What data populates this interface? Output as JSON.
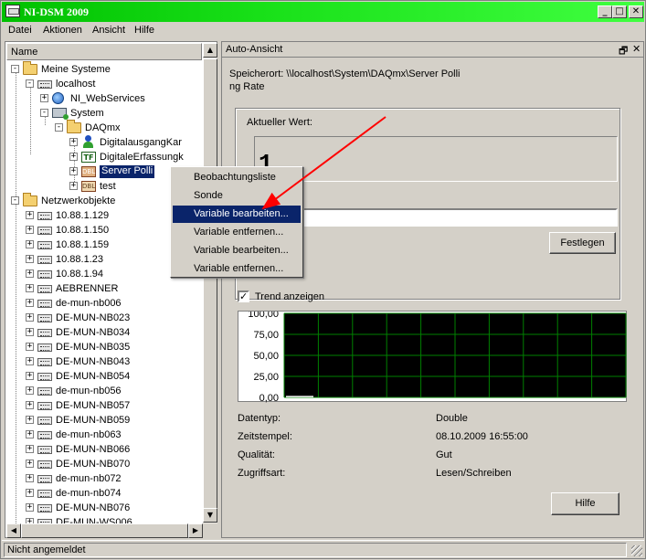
{
  "window": {
    "title": "NI-DSM 2009",
    "min": "_",
    "max": "□",
    "close": "✕"
  },
  "menu": [
    "Datei",
    "Aktionen",
    "Ansicht",
    "Hilfe"
  ],
  "tree": {
    "column_header": "Name",
    "items": [
      {
        "label": "Meine Systeme",
        "icon": "folder-icon"
      },
      {
        "label": "localhost",
        "icon": "server-icon"
      },
      {
        "label": "NI_WebServices",
        "icon": "globe-icon"
      },
      {
        "label": "System",
        "icon": "system-icon"
      },
      {
        "label": "DAQmx",
        "icon": "folder-icon"
      },
      {
        "label": "DigitalausgangKar",
        "icon": "person-icon"
      },
      {
        "label": "DigitaleErfassungk",
        "icon": "tf-icon"
      },
      {
        "label": "Server Polli",
        "icon": "dbl-icon",
        "selected": true
      },
      {
        "label": "test",
        "icon": "dbl-icon"
      },
      {
        "label": "Netzwerkobjekte",
        "icon": "folder-icon"
      },
      {
        "label": "10.88.1.129",
        "icon": "server-icon"
      },
      {
        "label": "10.88.1.150",
        "icon": "server-icon"
      },
      {
        "label": "10.88.1.159",
        "icon": "server-icon"
      },
      {
        "label": "10.88.1.23",
        "icon": "server-icon"
      },
      {
        "label": "10.88.1.94",
        "icon": "server-icon"
      },
      {
        "label": "AEBRENNER",
        "icon": "server-icon"
      },
      {
        "label": "de-mun-nb006",
        "icon": "server-icon"
      },
      {
        "label": "DE-MUN-NB023",
        "icon": "server-icon"
      },
      {
        "label": "DE-MUN-NB034",
        "icon": "server-icon"
      },
      {
        "label": "DE-MUN-NB035",
        "icon": "server-icon"
      },
      {
        "label": "DE-MUN-NB043",
        "icon": "server-icon"
      },
      {
        "label": "DE-MUN-NB054",
        "icon": "server-icon"
      },
      {
        "label": "de-mun-nb056",
        "icon": "server-icon"
      },
      {
        "label": "DE-MUN-NB057",
        "icon": "server-icon"
      },
      {
        "label": "DE-MUN-NB059",
        "icon": "server-icon"
      },
      {
        "label": "de-mun-nb063",
        "icon": "server-icon"
      },
      {
        "label": "DE-MUN-NB066",
        "icon": "server-icon"
      },
      {
        "label": "DE-MUN-NB070",
        "icon": "server-icon"
      },
      {
        "label": "de-mun-nb072",
        "icon": "server-icon"
      },
      {
        "label": "de-mun-nb074",
        "icon": "server-icon"
      },
      {
        "label": "DE-MUN-NB076",
        "icon": "server-icon"
      },
      {
        "label": "DE-MUN-WS006",
        "icon": "server-icon"
      }
    ]
  },
  "context_menu": [
    {
      "label": "Beobachtungsliste"
    },
    {
      "label": "Sonde"
    },
    {
      "label": "Variable bearbeiten...",
      "highlighted": true
    },
    {
      "label": "Variable entfernen..."
    },
    {
      "label": "Variable bearbeiten..."
    },
    {
      "label": "Variable entfernen..."
    }
  ],
  "panel": {
    "title": "Auto-Ansicht",
    "restore": "🗗",
    "close": "✕",
    "speicherort_line1": "Speicherort: \\\\localhost\\System\\DAQmx\\Server Polli",
    "speicherort_line2": "ng Rate",
    "current_value_label": "Aktueller Wert:",
    "current_value": "1",
    "input_value": "",
    "set_button": "Festlegen",
    "trend_checkbox_label": "Trend anzeigen",
    "trend_checked": true,
    "help_button": "Hilfe",
    "properties": [
      {
        "key": "Datentyp:",
        "value": "Double"
      },
      {
        "key": "Zeitstempel:",
        "value": "08.10.2009 16:55:00"
      },
      {
        "key": "Qualität:",
        "value": "Gut"
      },
      {
        "key": "Zugriffsart:",
        "value": "Lesen/Schreiben"
      }
    ]
  },
  "chart_data": {
    "type": "line",
    "y_ticks": [
      "100,00",
      "75,00",
      "50,00",
      "25,00",
      "0,00"
    ],
    "ylim": [
      0,
      100
    ],
    "grid": true,
    "background": "#000000",
    "grid_color": "#008000",
    "series": [
      {
        "values": [
          1,
          1,
          1,
          1
        ]
      }
    ]
  },
  "status": {
    "text": "Nicht angemeldet"
  },
  "colors": {
    "titlebar": "#18e018",
    "selection": "#0a246a",
    "arrow": "#ff0000"
  }
}
